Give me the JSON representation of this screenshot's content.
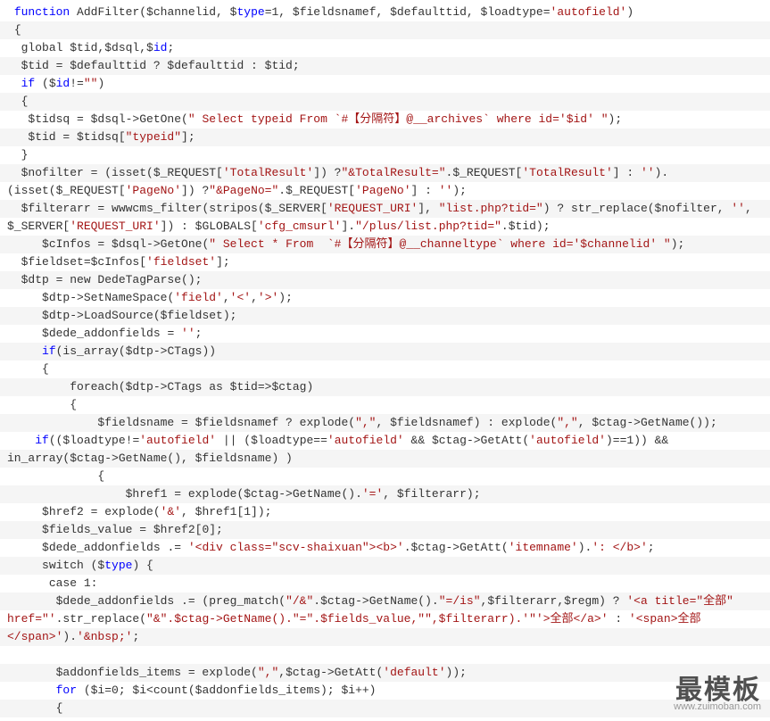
{
  "watermark": {
    "big": "最模板",
    "small": "www.zuimoban.com"
  },
  "lines": [
    {
      "indent": 1,
      "tokens": [
        {
          "t": "function",
          "c": "kw"
        },
        {
          "t": " AddFilter($channelid, $"
        },
        {
          "t": "type",
          "c": "kw"
        },
        {
          "t": "=1, $fieldsnamef, $defaulttid, $loadtype="
        },
        {
          "t": "'autofield'",
          "c": "str"
        },
        {
          "t": ")"
        }
      ]
    },
    {
      "indent": 1,
      "tokens": [
        {
          "t": "{"
        }
      ]
    },
    {
      "indent": 2,
      "tokens": [
        {
          "t": "global $tid,$dsql,$"
        },
        {
          "t": "id",
          "c": "kw"
        },
        {
          "t": ";"
        }
      ]
    },
    {
      "indent": 2,
      "tokens": [
        {
          "t": "$tid = $defaulttid ? $defaulttid : $tid;"
        }
      ]
    },
    {
      "indent": 2,
      "tokens": [
        {
          "t": "if",
          "c": "kw"
        },
        {
          "t": " ($"
        },
        {
          "t": "id",
          "c": "kw"
        },
        {
          "t": "!="
        },
        {
          "t": "\"\"",
          "c": "str"
        },
        {
          "t": ")"
        }
      ]
    },
    {
      "indent": 2,
      "tokens": [
        {
          "t": "{"
        }
      ]
    },
    {
      "indent": 3,
      "tokens": [
        {
          "t": "$tidsq = $dsql->GetOne("
        },
        {
          "t": "\" Select typeid From `#【分隔符】@__archives` where id='$id' \"",
          "c": "str"
        },
        {
          "t": ");"
        }
      ]
    },
    {
      "indent": 3,
      "tokens": [
        {
          "t": "$tid = $tidsq["
        },
        {
          "t": "\"typeid\"",
          "c": "str"
        },
        {
          "t": "];"
        }
      ]
    },
    {
      "indent": 2,
      "tokens": [
        {
          "t": "}"
        }
      ]
    },
    {
      "indent": 2,
      "tokens": [
        {
          "t": "$nofilter = (isset($_REQUEST["
        },
        {
          "t": "'TotalResult'",
          "c": "str"
        },
        {
          "t": "]) ?"
        },
        {
          "t": "\"&TotalResult=\"",
          "c": "str"
        },
        {
          "t": ".$_REQUEST["
        },
        {
          "t": "'TotalResult'",
          "c": "str"
        },
        {
          "t": "] : "
        },
        {
          "t": "''",
          "c": "str"
        },
        {
          "t": ")."
        }
      ]
    },
    {
      "indent": 0,
      "tokens": [
        {
          "t": "(isset($_REQUEST["
        },
        {
          "t": "'PageNo'",
          "c": "str"
        },
        {
          "t": "]) ?"
        },
        {
          "t": "\"&PageNo=\"",
          "c": "str"
        },
        {
          "t": ".$_REQUEST["
        },
        {
          "t": "'PageNo'",
          "c": "str"
        },
        {
          "t": "] : "
        },
        {
          "t": "''",
          "c": "str"
        },
        {
          "t": ");"
        }
      ]
    },
    {
      "indent": 2,
      "tokens": [
        {
          "t": "$filterarr = wwwcms_filter(stripos($_SERVER["
        },
        {
          "t": "'REQUEST_URI'",
          "c": "str"
        },
        {
          "t": "], "
        },
        {
          "t": "\"list.php?tid=\"",
          "c": "str"
        },
        {
          "t": ") ? str_replace($nofilter, "
        },
        {
          "t": "''",
          "c": "str"
        },
        {
          "t": ", "
        }
      ]
    },
    {
      "indent": 0,
      "tokens": [
        {
          "t": "$_SERVER["
        },
        {
          "t": "'REQUEST_URI'",
          "c": "str"
        },
        {
          "t": "]) : $GLOBALS["
        },
        {
          "t": "'cfg_cmsurl'",
          "c": "str"
        },
        {
          "t": "]."
        },
        {
          "t": "\"/plus/list.php?tid=\"",
          "c": "str"
        },
        {
          "t": ".$tid);"
        }
      ]
    },
    {
      "indent": 5,
      "tokens": [
        {
          "t": "$cInfos = $dsql->GetOne("
        },
        {
          "t": "\" Select * From  `#【分隔符】@__channeltype` where id='$channelid' \"",
          "c": "str"
        },
        {
          "t": ");"
        }
      ]
    },
    {
      "indent": 2,
      "tokens": [
        {
          "t": "$fieldset=$cInfos["
        },
        {
          "t": "'fieldset'",
          "c": "str"
        },
        {
          "t": "];"
        }
      ]
    },
    {
      "indent": 2,
      "tokens": [
        {
          "t": "$dtp = new DedeTagParse();"
        }
      ]
    },
    {
      "indent": 5,
      "tokens": [
        {
          "t": "$dtp->SetNameSpace("
        },
        {
          "t": "'field'",
          "c": "str"
        },
        {
          "t": ","
        },
        {
          "t": "'<'",
          "c": "str"
        },
        {
          "t": ","
        },
        {
          "t": "'>'",
          "c": "str"
        },
        {
          "t": ");"
        }
      ]
    },
    {
      "indent": 5,
      "tokens": [
        {
          "t": "$dtp->LoadSource($fieldset);"
        }
      ]
    },
    {
      "indent": 5,
      "tokens": [
        {
          "t": "$dede_addonfields = "
        },
        {
          "t": "''",
          "c": "str"
        },
        {
          "t": ";"
        }
      ]
    },
    {
      "indent": 5,
      "tokens": [
        {
          "t": "if",
          "c": "kw"
        },
        {
          "t": "(is_array($dtp->CTags))"
        }
      ]
    },
    {
      "indent": 5,
      "tokens": [
        {
          "t": "{"
        }
      ]
    },
    {
      "indent": 9,
      "tokens": [
        {
          "t": "foreach($dtp->CTags as $tid=>$ctag)"
        }
      ]
    },
    {
      "indent": 9,
      "tokens": [
        {
          "t": "{"
        }
      ]
    },
    {
      "indent": 13,
      "tokens": [
        {
          "t": "$fieldsname = $fieldsnamef ? explode("
        },
        {
          "t": "\",\"",
          "c": "str"
        },
        {
          "t": ", $fieldsnamef) : explode("
        },
        {
          "t": "\",\"",
          "c": "str"
        },
        {
          "t": ", $ctag->GetName());"
        }
      ]
    },
    {
      "indent": 4,
      "tokens": [
        {
          "t": "if",
          "c": "kw"
        },
        {
          "t": "(($loadtype!="
        },
        {
          "t": "'autofield'",
          "c": "str"
        },
        {
          "t": " || ($loadtype=="
        },
        {
          "t": "'autofield'",
          "c": "str"
        },
        {
          "t": " && $ctag->GetAtt("
        },
        {
          "t": "'autofield'",
          "c": "str"
        },
        {
          "t": ")==1)) && "
        }
      ]
    },
    {
      "indent": 0,
      "tokens": [
        {
          "t": "in_array($ctag->GetName(), $fieldsname) )"
        }
      ]
    },
    {
      "indent": 13,
      "tokens": [
        {
          "t": "{"
        }
      ]
    },
    {
      "indent": 17,
      "tokens": [
        {
          "t": "$href1 = explode($ctag->GetName()."
        },
        {
          "t": "'='",
          "c": "str"
        },
        {
          "t": ", $filterarr);"
        }
      ]
    },
    {
      "indent": 5,
      "tokens": [
        {
          "t": "$href2 = explode("
        },
        {
          "t": "'&'",
          "c": "str"
        },
        {
          "t": ", $href1[1]);"
        }
      ]
    },
    {
      "indent": 5,
      "tokens": [
        {
          "t": "$fields_value = $href2[0];"
        }
      ]
    },
    {
      "indent": 5,
      "tokens": [
        {
          "t": "$dede_addonfields .= "
        },
        {
          "t": "'<div class=\"scv-shaixuan\"><b>'",
          "c": "str"
        },
        {
          "t": ".$ctag->GetAtt("
        },
        {
          "t": "'itemname'",
          "c": "str"
        },
        {
          "t": ")."
        },
        {
          "t": "': </b>'",
          "c": "str"
        },
        {
          "t": ";"
        }
      ]
    },
    {
      "indent": 5,
      "tokens": [
        {
          "t": "switch ($"
        },
        {
          "t": "type",
          "c": "kw"
        },
        {
          "t": ") {"
        }
      ]
    },
    {
      "indent": 6,
      "tokens": [
        {
          "t": "case 1:"
        }
      ]
    },
    {
      "indent": 7,
      "tokens": [
        {
          "t": "$dede_addonfields .= (preg_match("
        },
        {
          "t": "\"/&\"",
          "c": "str"
        },
        {
          "t": ".$ctag->GetName()."
        },
        {
          "t": "\"=/is\"",
          "c": "str"
        },
        {
          "t": ",$filterarr,$regm) ? "
        },
        {
          "t": "'<a title=\"全部\" ",
          "c": "str"
        }
      ]
    },
    {
      "indent": 0,
      "tokens": [
        {
          "t": "href=\"'",
          "c": "str"
        },
        {
          "t": ".str_replace("
        },
        {
          "t": "\"&\".$ctag->GetName().\"=\".$fields_value,\"\",$filterarr).'\"",
          "c": "str"
        },
        {
          "t": "'>全部</a>'",
          "c": "str"
        },
        {
          "t": " : "
        },
        {
          "t": "'<span>全部",
          "c": "str"
        }
      ]
    },
    {
      "indent": 0,
      "tokens": [
        {
          "t": "</span>'",
          "c": "str"
        },
        {
          "t": ")."
        },
        {
          "t": "'&nbsp;'",
          "c": "str"
        },
        {
          "t": ";"
        }
      ]
    },
    {
      "indent": 0,
      "tokens": [
        {
          "t": ""
        }
      ]
    },
    {
      "indent": 7,
      "tokens": [
        {
          "t": "$addonfields_items = explode("
        },
        {
          "t": "\",\"",
          "c": "str"
        },
        {
          "t": ",$ctag->GetAtt("
        },
        {
          "t": "'default'",
          "c": "str"
        },
        {
          "t": "));"
        }
      ]
    },
    {
      "indent": 7,
      "tokens": [
        {
          "t": "for",
          "c": "kw"
        },
        {
          "t": " ($i=0; $i<count($addonfields_items); $i++)"
        }
      ]
    },
    {
      "indent": 7,
      "tokens": [
        {
          "t": "{"
        }
      ]
    }
  ]
}
